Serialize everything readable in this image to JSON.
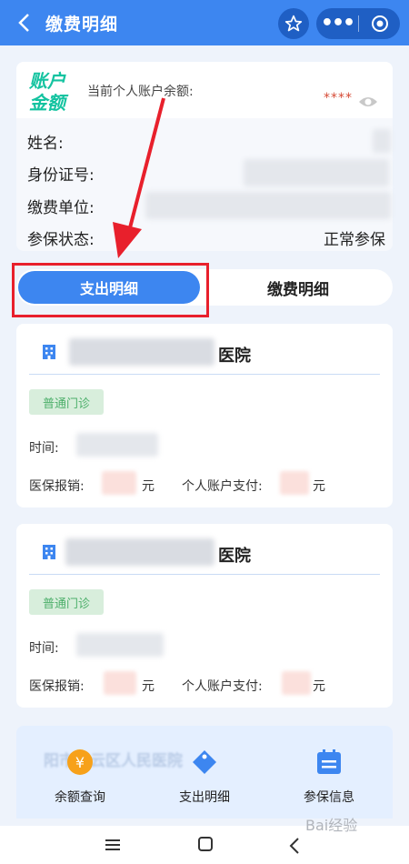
{
  "header": {
    "back_label": "<",
    "title": "缴费明细",
    "more_label": "•••"
  },
  "account": {
    "logo_text_line1": "账户",
    "logo_text_line2": "金额",
    "balance_label": "当前个人账户余额:",
    "balance_masked": "****",
    "fields": {
      "name_label": "姓名:",
      "id_label": "身份证号:",
      "unit_label": "缴费单位:",
      "status_label": "参保状态:",
      "status_value": "正常参保"
    }
  },
  "tabs": {
    "expense": "支出明细",
    "payment": "缴费明细"
  },
  "records": [
    {
      "hospital_suffix": "医院",
      "visit_type": "普通门诊",
      "time_label": "时间:",
      "insurance_label": "医保报销:",
      "insurance_unit": "元",
      "personal_label": "个人账户支付:",
      "personal_unit": "元"
    },
    {
      "hospital_suffix": "医院",
      "visit_type": "普通门诊",
      "time_label": "时间:",
      "insurance_label": "医保报销:",
      "insurance_unit": "元",
      "personal_label": "个人账户支付:",
      "personal_unit": "元"
    }
  ],
  "ghost_text": "阳市白云区人民医院",
  "bottom_nav": {
    "balance_icon_glyph": "¥",
    "balance": "余额查询",
    "expense": "支出明细",
    "insurance": "参保信息"
  },
  "watermark": "Bai经验",
  "colors": {
    "primary": "#3d86f0",
    "highlight": "#e8202c",
    "badge_text": "#4caf6a",
    "masked_stars": "#d64a35"
  }
}
